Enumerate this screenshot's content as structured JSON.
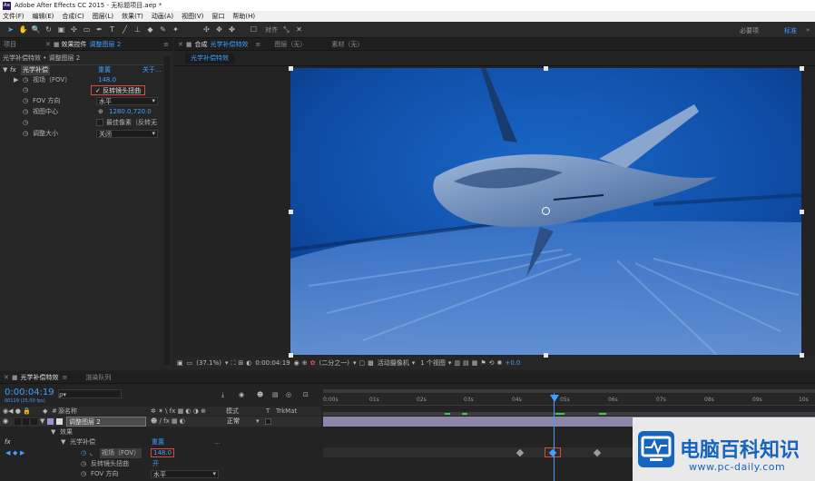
{
  "window": {
    "title": "Adobe After Effects CC 2015 - 无标题项目.aep *",
    "app_icon": "Ae"
  },
  "menu": [
    "文件(F)",
    "编辑(E)",
    "合成(C)",
    "图层(L)",
    "效果(T)",
    "动画(A)",
    "视图(V)",
    "窗口",
    "帮助(H)"
  ],
  "toolbar": {
    "snap_label": "对齐",
    "workspace_label": "必要项",
    "standard_label": "标准",
    "tools": [
      "selection-icon",
      "hand-icon",
      "zoom-icon",
      "rotate-icon",
      "camera-icon",
      "pan-icon",
      "rectangle-icon",
      "pen-icon",
      "type-icon",
      "brush-icon",
      "clone-stamp-icon",
      "eraser-icon",
      "roto-brush-icon",
      "puppet-pin-icon"
    ]
  },
  "left_panel": {
    "tab_project": "项目",
    "tab_effects": "效果控件",
    "tab_effects_layer": "调整图层 2",
    "header": "光学补偿特效 • 调整图层 2",
    "effect_name": "光学补偿",
    "reset_label": "重置",
    "about_label": "关于...",
    "rows": [
      {
        "label": "视场（FOV）",
        "value": "148.0"
      },
      {
        "label": "",
        "value": "反转镜头扭曲",
        "checked": true
      },
      {
        "label": "FOV 方向",
        "value": "水平"
      },
      {
        "label": "视图中心",
        "value": "1280.0,720.0"
      },
      {
        "label": "",
        "value": "最佳像素（反转无"
      },
      {
        "label": "调整大小",
        "value": "关闭"
      }
    ]
  },
  "comp_panel": {
    "tab_comp": "合成",
    "comp_name": "光学补偿特效",
    "tab_layer": "图层（无）",
    "tab_footage": "素材（无）",
    "sub_tab": "光学补偿特效",
    "zoom": "(37.1%)",
    "timecode": "0:00:04:19",
    "resolution": "(二分之一)",
    "camera": "活动摄像机",
    "views": "1 个视图",
    "exposure": "+0.0"
  },
  "timeline": {
    "tab_comp": "光学补偿特效",
    "tab_render": "渲染队列",
    "timecode": "0:00:04:19",
    "frame_info": "00119 (25.00 fps)",
    "col_source": "源名称",
    "col_mode": "模式",
    "col_t": "T",
    "col_trkmat": "TrkMat",
    "layer_num": "1",
    "layer_name": "调整图层 2",
    "mode_value": "正常",
    "effects_label": "效果",
    "effect_name": "光学补偿",
    "reset_label": "重置",
    "prop_fov": "视场（FOV）",
    "prop_fov_value": "148.0",
    "prop_reverse": "反转镜头扭曲",
    "prop_reverse_value": "开",
    "prop_fov_dir": "FOV 方向",
    "prop_fov_dir_value": "水平",
    "ruler": [
      "0:00s",
      "01s",
      "02s",
      "03s",
      "04s",
      "05s",
      "06s",
      "07s",
      "08s",
      "09s",
      "10s"
    ]
  },
  "watermark": {
    "title": "电脑百科知识",
    "url": "www.pc-daily.com"
  },
  "colors": {
    "accent_blue": "#3fa0ff",
    "playhead": "#3fa0ff",
    "highlight_box": "#d94a3a",
    "watermark_blue": "#1565c0"
  }
}
